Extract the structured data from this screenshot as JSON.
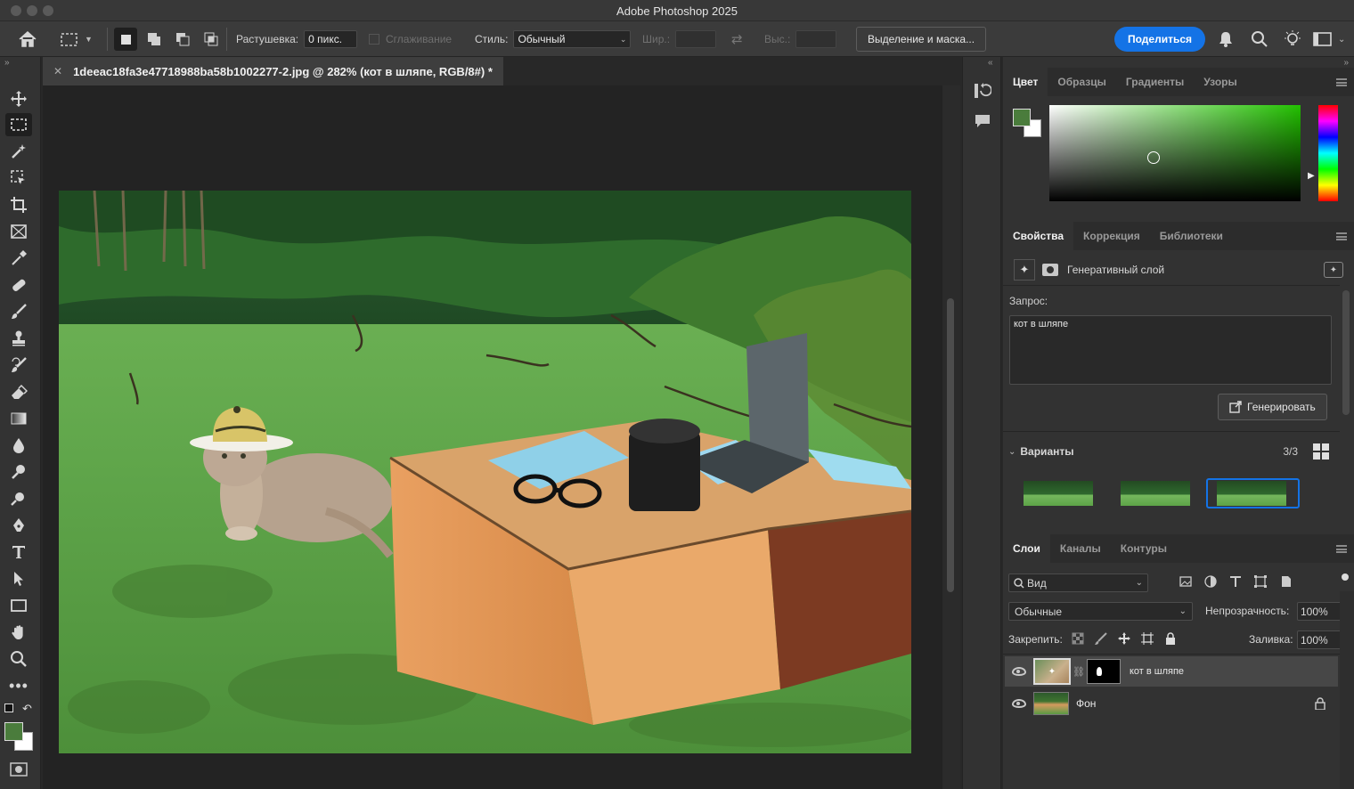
{
  "window": {
    "title": "Adobe Photoshop 2025"
  },
  "options_bar": {
    "feather_label": "Растушевка:",
    "feather_value": "0 пикс.",
    "antialias_label": "Сглаживание",
    "style_label": "Стиль:",
    "style_value": "Обычный",
    "width_label": "Шир.:",
    "height_label": "Выс.:",
    "select_mask_button": "Выделение и маска...",
    "share_button": "Поделиться"
  },
  "document": {
    "tab_title": "1deeac18fa3e47718988ba58b1002277-2.jpg @ 282% (кот в шляпе, RGB/8#) *"
  },
  "color_panel": {
    "tabs": [
      "Цвет",
      "Образцы",
      "Градиенты",
      "Узоры"
    ],
    "foreground_color": "#4a7c3c",
    "hue_color": "#22c000"
  },
  "properties_panel": {
    "tabs": [
      "Свойства",
      "Коррекция",
      "Библиотеки"
    ],
    "layer_type": "Генеративный слой",
    "prompt_label": "Запрос:",
    "prompt_text": "кот в шляпе",
    "generate_button": "Генерировать",
    "variants_label": "Варианты",
    "variants_count": "3/3"
  },
  "layers_panel": {
    "tabs": [
      "Слои",
      "Каналы",
      "Контуры"
    ],
    "filter_label": "Вид",
    "blend_mode": "Обычные",
    "opacity_label": "Непрозрачность:",
    "opacity_value": "100%",
    "lock_label": "Закрепить:",
    "fill_label": "Заливка:",
    "fill_value": "100%",
    "layers": [
      {
        "name": "кот в шляпе"
      },
      {
        "name": "Фон"
      }
    ]
  }
}
